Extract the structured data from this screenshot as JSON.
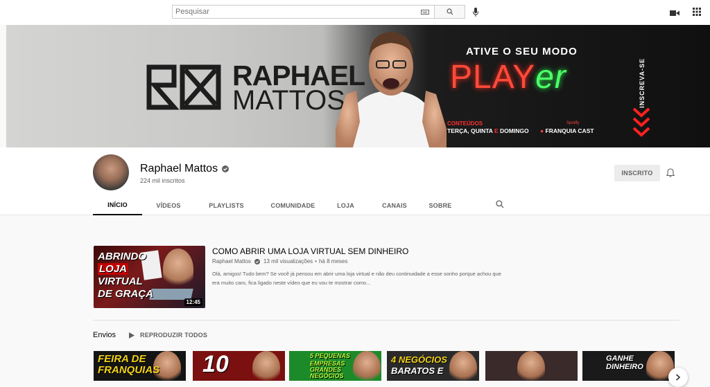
{
  "search": {
    "placeholder": "Pesquisar"
  },
  "banner": {
    "name_line1": "RAPHAEL",
    "name_line2": "MATTOS",
    "tagline": "ATIVE O SEU MODO",
    "player_main": "PLAY",
    "player_accent": "er",
    "conteudos": "CONTEÚDOS",
    "dias_before": "TERÇA, QUINTA ",
    "dias_e": "E",
    "dias_after": " DOMINGO",
    "spotify": "Spotify",
    "cast": "FRANQUIA CAST",
    "inscreva": "INSCREVA-SE"
  },
  "channel": {
    "name": "Raphael Mattos",
    "subscribers": "224 mil inscritos",
    "subscribe_label": "INSCRITO"
  },
  "tabs": [
    "INÍCIO",
    "VÍDEOS",
    "PLAYLISTS",
    "COMUNIDADE",
    "LOJA",
    "CANAIS",
    "SOBRE"
  ],
  "featured": {
    "title": "COMO ABRIR UMA LOJA VIRTUAL SEM DINHEIRO",
    "channel": "Raphael Mattos",
    "views": "13 mil visualizações",
    "age": "há 8 meses",
    "description": "Olá, amigos! Tudo bem? Se você já pensou em abrir uma loja virtual e não deu continuidade a esse sonho porque achou que era muito caro, fica ligado neste vídeo que eu vou te mostrar como...",
    "duration": "12:45",
    "thumb_line1": "ABRINDO",
    "thumb_line2": "LOJA",
    "thumb_line3": "VIRTUAL",
    "thumb_line4": "DE GRAÇA"
  },
  "shelf": {
    "title": "Envios",
    "play_all": "REPRODUZIR TODOS",
    "thumbs": [
      {
        "line1": "FEIRA DE",
        "line2": "FRANQUIAS",
        "bg": "#141414",
        "accent": "#f2d21a"
      },
      {
        "line1": "10",
        "line2": "",
        "bg": "#7a1010",
        "accent": "#ffffff"
      },
      {
        "line1": "5 PEQUENAS",
        "line2": "EMPRESAS GRANDES NEGÓCIOS",
        "bg": "#1d8a2a",
        "accent": "#b8ff3a"
      },
      {
        "line1": "4 NEGÓCIOS",
        "line2": "BARATOS E",
        "bg": "#2a2a2a",
        "accent": "#f2d21a"
      },
      {
        "line1": "",
        "line2": "",
        "bg": "#3a2a2a",
        "accent": "#ffffff"
      },
      {
        "line1": "GANHE",
        "line2": "DINHEIRO",
        "bg": "#1a1a1a",
        "accent": "#7ae05a"
      }
    ]
  },
  "colors": {
    "accent_red": "#ff0000",
    "text_primary": "#030303",
    "text_secondary": "#606060"
  }
}
